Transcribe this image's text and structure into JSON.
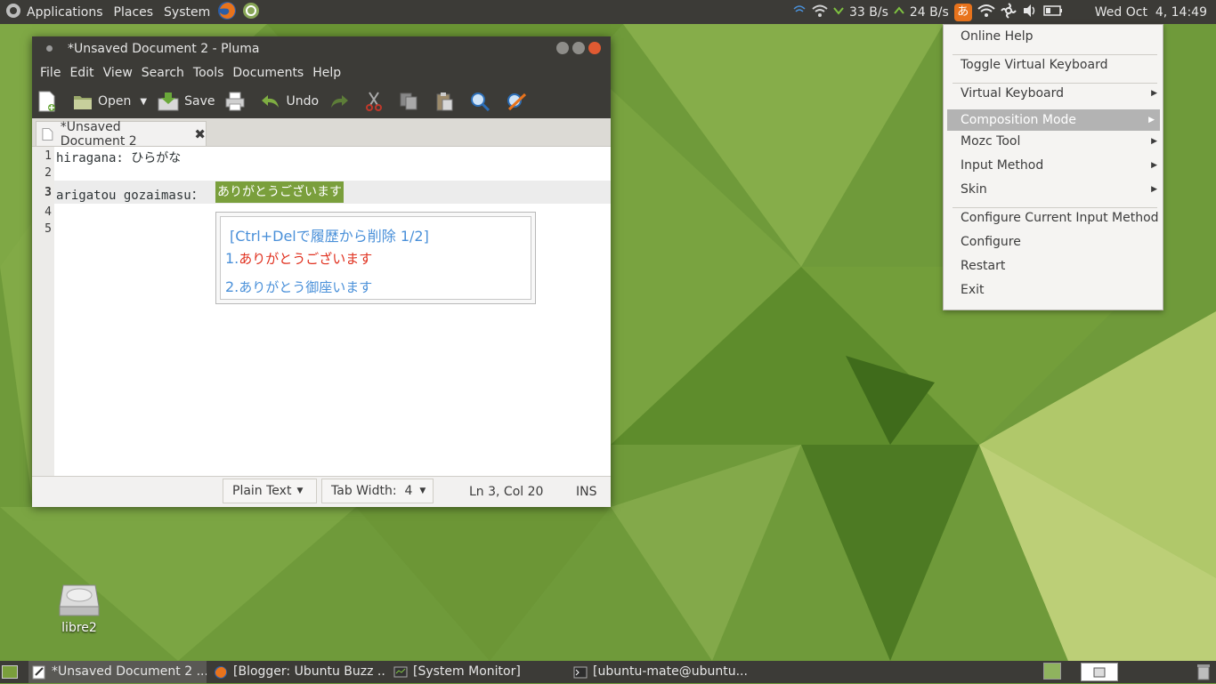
{
  "top_panel": {
    "menu": [
      "Applications",
      "Places",
      "System"
    ],
    "net_down": "33 B/s",
    "net_up": "24 B/s",
    "ime_indicator": "あ",
    "clock": "Wed Oct  4, 14:49"
  },
  "window": {
    "title": "*Unsaved Document 2 - Pluma",
    "menu": [
      "File",
      "Edit",
      "View",
      "Search",
      "Tools",
      "Documents",
      "Help"
    ],
    "toolbar": {
      "open": "Open",
      "save": "Save",
      "undo": "Undo"
    },
    "tab_label": "*Unsaved Document 2",
    "lines": [
      {
        "num": "1",
        "text": "hiragana: ひらがな"
      },
      {
        "num": "2",
        "text": ""
      },
      {
        "num": "3",
        "text": "arigatou gozaimasu："
      },
      {
        "num": "4",
        "text": ""
      },
      {
        "num": "5",
        "text": ""
      }
    ],
    "preedit": "ありがとうございます",
    "candidates": {
      "header": "[Ctrl+Delで履歴から削除 1/2]",
      "items": [
        {
          "index": "1.",
          "text": "ありがとうございます"
        },
        {
          "index": "2.",
          "text": "ありがとう御座います"
        }
      ]
    },
    "status": {
      "language": "Plain Text",
      "tab_width": "Tab Width:  4",
      "position": "Ln 3, Col 20",
      "mode": "INS"
    }
  },
  "context_menu": {
    "items": [
      {
        "label": "Online Help"
      },
      {
        "label": "Toggle Virtual Keyboard"
      },
      {
        "label": "Virtual Keyboard"
      },
      {
        "label": "Composition Mode"
      },
      {
        "label": "Mozc Tool"
      },
      {
        "label": "Input Method"
      },
      {
        "label": "Skin"
      },
      {
        "label": "Configure Current Input Method"
      },
      {
        "label": "Configure"
      },
      {
        "label": "Restart"
      },
      {
        "label": "Exit"
      }
    ]
  },
  "desktop": {
    "drive_label": "libre2"
  },
  "taskbar": {
    "tasks": [
      "*Unsaved Document 2 ...",
      "[Blogger: Ubuntu Buzz ...",
      "[System Monitor]",
      "[ubuntu-mate@ubuntu..."
    ]
  },
  "colors": {
    "panel": "#3c3b37",
    "preedit_bg": "#7a9f3c",
    "candidate_selected": "#e0301e",
    "candidate_normal": "#4a90d9"
  }
}
